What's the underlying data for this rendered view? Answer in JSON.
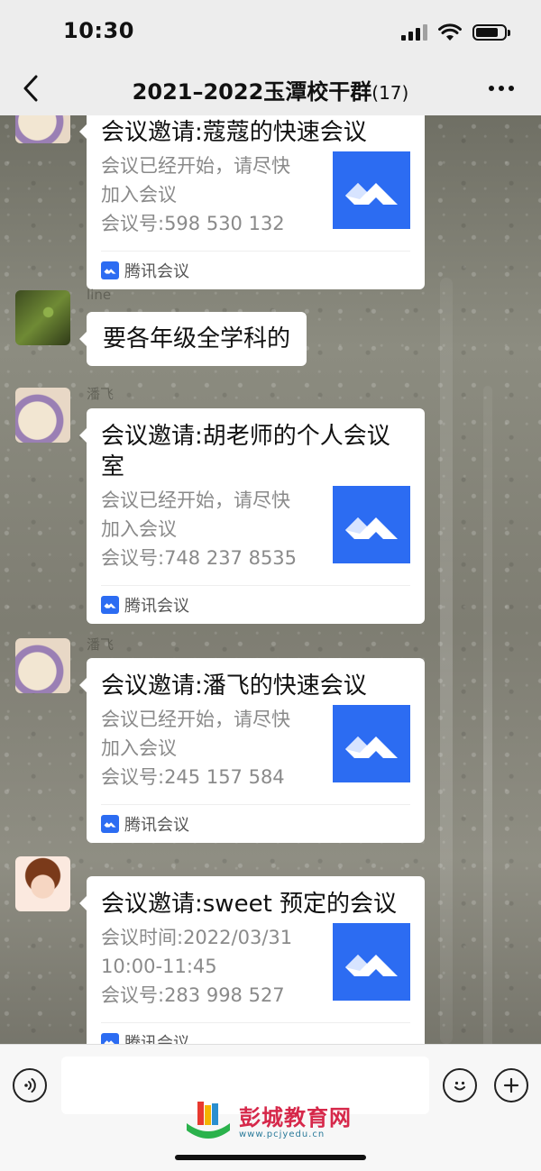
{
  "status_bar": {
    "time": "10:30",
    "battery_level": 0.8
  },
  "nav": {
    "title": "2021–2022玉潭校干群",
    "member_count": "(17)"
  },
  "messages": [
    {
      "type": "meeting_card",
      "title": "会议邀请:蔻蔻的快速会议",
      "desc_line1": "会议已经开始，请尽快",
      "desc_line2": "加入会议",
      "meeting_no": "会议号:598 530 132",
      "source": "腾讯会议"
    },
    {
      "type": "text",
      "sender": "line",
      "text": "要各年级全学科的"
    },
    {
      "type": "meeting_card",
      "sender": "潘飞",
      "title": "会议邀请:胡老师的个人会议室",
      "desc_line1": "会议已经开始，请尽快",
      "desc_line2": "加入会议",
      "meeting_no": "会议号:748 237 8535",
      "source": "腾讯会议"
    },
    {
      "type": "meeting_card",
      "sender": "潘飞",
      "title": "会议邀请:潘飞的快速会议",
      "desc_line1": "会议已经开始，请尽快",
      "desc_line2": "加入会议",
      "meeting_no": "会议号:245 157 584",
      "source": "腾讯会议"
    },
    {
      "type": "meeting_card",
      "sender": "",
      "title": "会议邀请:sweet 预定的会议",
      "desc_line1": "会议时间:2022/03/31",
      "desc_line2": "10:00-11:45",
      "meeting_no": "会议号:283 998 527",
      "source": "腾讯会议"
    }
  ],
  "watermark": {
    "main": "彭城教育网",
    "url": "www.pcjyedu.cn"
  },
  "colors": {
    "tencent_meeting_blue": "#2c6cf2",
    "watermark_red": "#d6284a"
  }
}
